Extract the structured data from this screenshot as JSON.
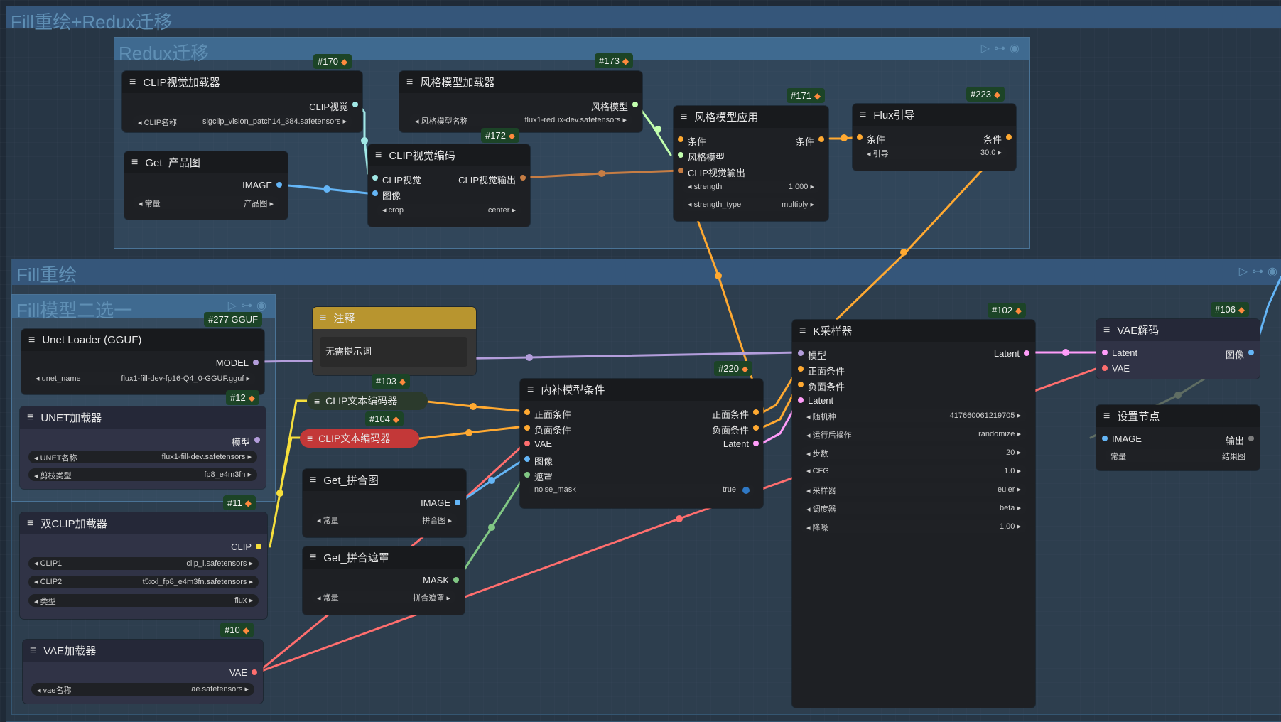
{
  "groups": {
    "outer1": {
      "title": "Fill重绘+Redux迁移"
    },
    "redux": {
      "title": "Redux迁移"
    },
    "fill": {
      "title": "Fill重绘"
    },
    "fillModel": {
      "title": "Fill模型二选一"
    }
  },
  "nodes": {
    "n170": {
      "id": "#170",
      "title": "CLIP视觉加载器",
      "out": "CLIP视觉",
      "w_label": "CLIP名称",
      "w_value": "sigclip_vision_patch14_384.safetensors"
    },
    "n173": {
      "id": "#173",
      "title": "风格模型加载器",
      "out": "风格模型",
      "w_label": "风格模型名称",
      "w_value": "flux1-redux-dev.safetensors"
    },
    "n172": {
      "id": "#172",
      "title": "CLIP视觉编码",
      "in1": "CLIP视觉",
      "in2": "图像",
      "out": "CLIP视觉输出",
      "w_label": "crop",
      "w_value": "center"
    },
    "getProduct": {
      "title": "Get_产品图",
      "out": "IMAGE",
      "w_label": "常量",
      "w_value": "产品图"
    },
    "n171": {
      "id": "#171",
      "title": "风格模型应用",
      "in1": "条件",
      "in2": "风格模型",
      "in3": "CLIP视觉输出",
      "out": "条件",
      "w1_label": "strength",
      "w1_value": "1.000",
      "w2_label": "strength_type",
      "w2_value": "multiply"
    },
    "n223": {
      "id": "#223",
      "title": "Flux引导",
      "in1": "条件",
      "out": "条件",
      "w_label": "引导",
      "w_value": "30.0"
    },
    "n277": {
      "id": "#277 GGUF",
      "title": "Unet Loader (GGUF)",
      "out": "MODEL",
      "w_label": "unet_name",
      "w_value": "flux1-fill-dev-fp16-Q4_0-GGUF.gguf"
    },
    "n12": {
      "id": "#12",
      "title": "UNET加载器",
      "out": "模型",
      "w1_label": "UNET名称",
      "w1_value": "flux1-fill-dev.safetensors",
      "w2_label": "剪枝类型",
      "w2_value": "fp8_e4m3fn"
    },
    "note": {
      "title": "注释",
      "text": "无需提示词"
    },
    "n103": {
      "id": "#103",
      "title": "CLIP文本编码器"
    },
    "n104": {
      "id": "#104",
      "title": "CLIP文本编码器"
    },
    "getMerge": {
      "title": "Get_拼合图",
      "out": "IMAGE",
      "w_label": "常量",
      "w_value": "拼合图"
    },
    "getMask": {
      "title": "Get_拼合遮罩",
      "out": "MASK",
      "w_label": "常量",
      "w_value": "拼合遮罩"
    },
    "n11": {
      "id": "#11",
      "title": "双CLIP加载器",
      "out": "CLIP",
      "w1_label": "CLIP1",
      "w1_value": "clip_l.safetensors",
      "w2_label": "CLIP2",
      "w2_value": "t5xxl_fp8_e4m3fn.safetensors",
      "w3_label": "类型",
      "w3_value": "flux"
    },
    "n10": {
      "id": "#10",
      "title": "VAE加载器",
      "out": "VAE",
      "w_label": "vae名称",
      "w_value": "ae.safetensors"
    },
    "n220": {
      "id": "#220",
      "title": "内补模型条件",
      "in1": "正面条件",
      "in2": "负面条件",
      "in3": "VAE",
      "in4": "图像",
      "in5": "遮罩",
      "out1": "正面条件",
      "out2": "负面条件",
      "out3": "Latent",
      "w_label": "noise_mask",
      "w_value": "true"
    },
    "n102": {
      "id": "#102",
      "title": "K采样器",
      "in1": "模型",
      "in2": "正面条件",
      "in3": "负面条件",
      "in4": "Latent",
      "out": "Latent",
      "w": [
        {
          "l": "随机种",
          "v": "417660061219705"
        },
        {
          "l": "运行后操作",
          "v": "randomize"
        },
        {
          "l": "步数",
          "v": "20"
        },
        {
          "l": "CFG",
          "v": "1.0"
        },
        {
          "l": "采样器",
          "v": "euler"
        },
        {
          "l": "调度器",
          "v": "beta"
        },
        {
          "l": "降噪",
          "v": "1.00"
        }
      ]
    },
    "n106": {
      "id": "#106",
      "title": "VAE解码",
      "in1": "Latent",
      "in2": "VAE",
      "out": "图像"
    },
    "settings": {
      "title": "设置节点",
      "in1": "IMAGE",
      "out": "输出",
      "w_label": "常量",
      "w_value": "结果图"
    }
  },
  "colors": {
    "clip": "#f6df3c",
    "conditioning": "#ffa931",
    "model": "#b39ddb",
    "vae": "#ff6e6e",
    "image": "#64b5f6",
    "mask": "#81c784",
    "latent": "#ff9cf9",
    "clipvision": "#a1e8e6",
    "style": "#c2ffae",
    "clipvisionout": "#c67d44"
  },
  "icons": {
    "menu": "menu-icon",
    "fox": "fox-icon",
    "play": "play-icon",
    "link": "link-icon",
    "eye": "eye-icon"
  }
}
